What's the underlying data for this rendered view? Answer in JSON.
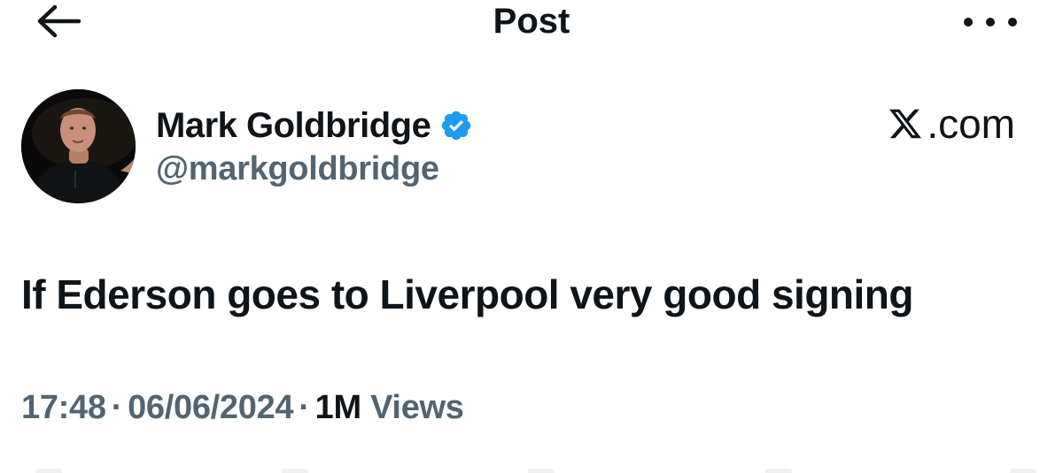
{
  "header": {
    "title": "Post",
    "back_icon": "arrow-left-icon",
    "more_icon": "more-horizontal-icon"
  },
  "author": {
    "name": "Mark Goldbridge",
    "handle": "@markgoldbridge",
    "verified": true,
    "verified_color": "#1d9bf0"
  },
  "watermark": {
    "text": ".com",
    "logo_icon": "x-logo-icon"
  },
  "post": {
    "text": "If Ederson goes to Liverpool very good signing"
  },
  "meta": {
    "time": "17:48",
    "separator": "·",
    "date": "06/06/2024",
    "views_count": "1M",
    "views_label": "Views"
  },
  "colors": {
    "primary_text": "#0f1419",
    "secondary_text": "#536471",
    "background": "#ffffff"
  }
}
